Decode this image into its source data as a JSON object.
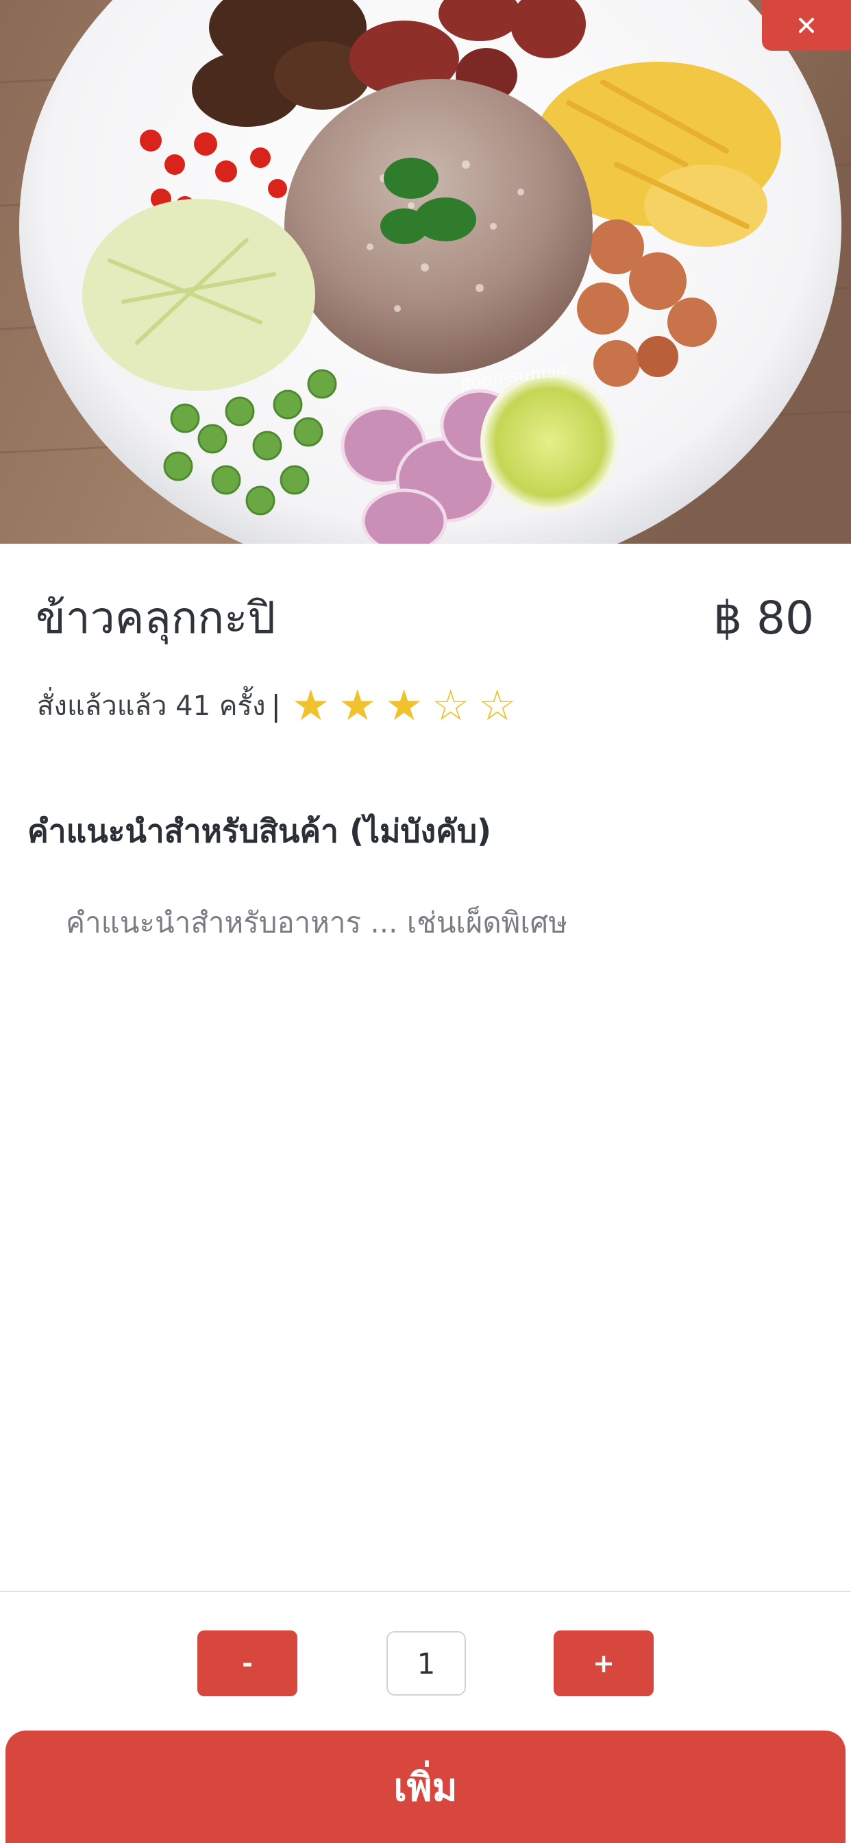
{
  "hero": {
    "image_name": "khao-kluk-kapi-dish-photo",
    "watermark": "poon-sunisa"
  },
  "close": {
    "icon": "close-icon",
    "label": "×"
  },
  "product": {
    "name": "ข้าวคลุกกะปิ",
    "price": "฿ 80",
    "order_count": "สั่งแล้วแล้ว 41 ครั้ง",
    "separator": "|",
    "rating": {
      "value": 3,
      "max": 5,
      "filled_glyph": "★",
      "empty_glyph": "☆"
    }
  },
  "note": {
    "heading": "คำแนะนำสำหรับสินค้า (ไม่บังคับ)",
    "placeholder": "คำแนะนำสำหรับอาหาร ... เช่นเผ็ดพิเศษ",
    "value": ""
  },
  "quantity": {
    "minus_label": "-",
    "value": "1",
    "plus_label": "+"
  },
  "add_button": {
    "label": "เพิ่ม"
  },
  "colors": {
    "accent": "#d7473e",
    "star": "#f2c12e",
    "text": "#2f333a"
  }
}
